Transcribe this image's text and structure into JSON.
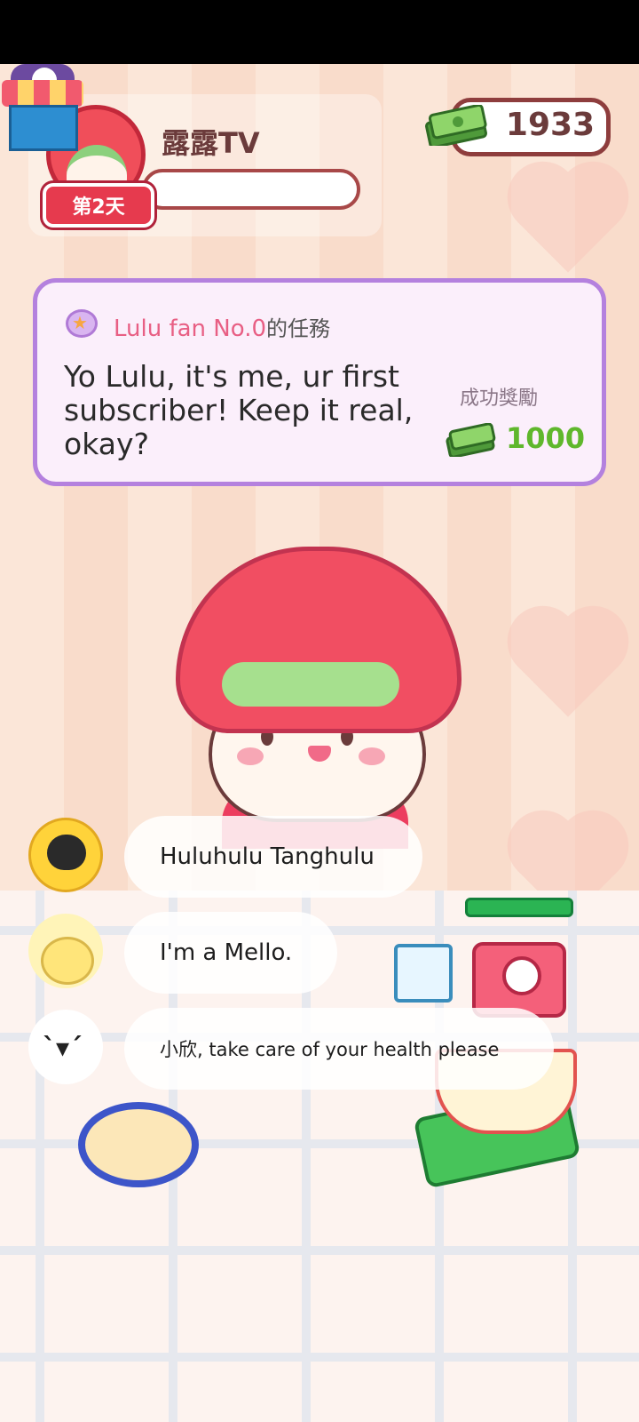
{
  "header": {
    "channel_name": "露露TV",
    "day_badge": "第2天",
    "cash": "1933"
  },
  "quest": {
    "from": "Lulu fan No.0",
    "suffix": "的任務",
    "message": "Yo Lulu, it's me, ur first subscriber! Keep it real, okay?",
    "reward_label": "成功獎勵",
    "reward_value": "1000"
  },
  "comments": [
    {
      "text": "Huluhulu Tanghulu"
    },
    {
      "text": "I'm a Mello."
    },
    {
      "text": "小欣, take care of your health please"
    }
  ],
  "colors": {
    "accent_quest_border": "#b481de",
    "reward_green": "#5fb72c",
    "quest_name_pink": "#e85f84"
  }
}
